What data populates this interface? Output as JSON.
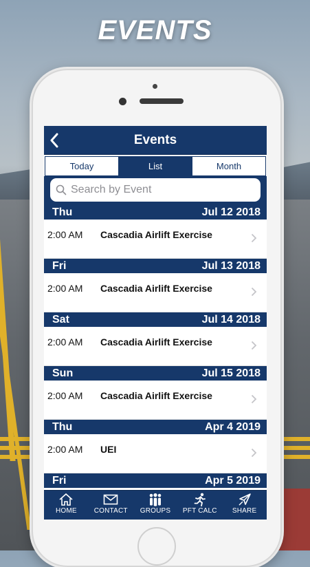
{
  "promo": {
    "headline": "EVENTS"
  },
  "navbar": {
    "back_icon": "chevron-left-icon",
    "title": "Events"
  },
  "segments": [
    {
      "label": "Today",
      "active": false
    },
    {
      "label": "List",
      "active": true
    },
    {
      "label": "Month",
      "active": false
    }
  ],
  "search": {
    "placeholder": "Search by Event"
  },
  "days": [
    {
      "weekday": "Thu",
      "date": "Jul 12 2018",
      "events": [
        {
          "time": "2:00 AM",
          "title": "Cascadia Airlift Exercise"
        }
      ]
    },
    {
      "weekday": "Fri",
      "date": "Jul 13 2018",
      "events": [
        {
          "time": "2:00 AM",
          "title": "Cascadia Airlift Exercise"
        }
      ]
    },
    {
      "weekday": "Sat",
      "date": "Jul 14 2018",
      "events": [
        {
          "time": "2:00 AM",
          "title": "Cascadia Airlift Exercise"
        }
      ]
    },
    {
      "weekday": "Sun",
      "date": "Jul 15 2018",
      "events": [
        {
          "time": "2:00 AM",
          "title": "Cascadia Airlift Exercise"
        }
      ]
    },
    {
      "weekday": "Thu",
      "date": "Apr 4 2019",
      "events": [
        {
          "time": "2:00 AM",
          "title": "UEI"
        }
      ]
    },
    {
      "weekday": "Fri",
      "date": "Apr 5 2019",
      "events": []
    }
  ],
  "tabbar": [
    {
      "label": "HOME",
      "icon": "home-icon"
    },
    {
      "label": "CONTACT",
      "icon": "envelope-icon"
    },
    {
      "label": "GROUPS",
      "icon": "groups-icon"
    },
    {
      "label": "PFT CALC",
      "icon": "runner-icon"
    },
    {
      "label": "SHARE",
      "icon": "share-icon"
    }
  ],
  "colors": {
    "brand": "#16386a",
    "headline": "#ffffff"
  }
}
